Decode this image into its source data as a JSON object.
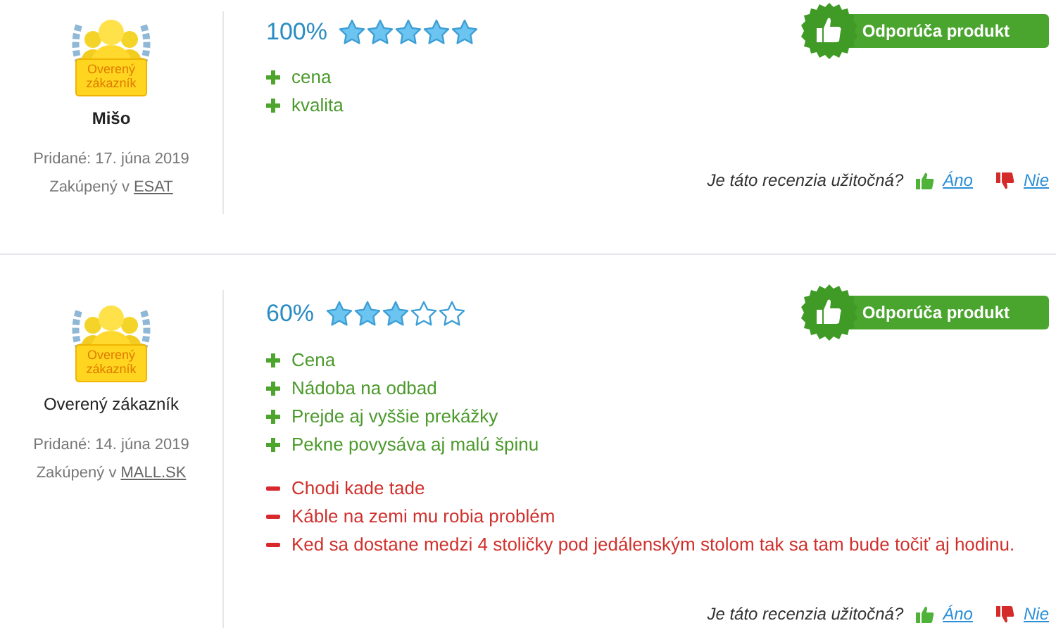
{
  "reviews": [
    {
      "badge_label": "Overený zákazník",
      "name": "Mišo",
      "added": "Pridané: 17. júna 2019",
      "purchased_prefix": "Zakúpený v",
      "shop": "ESAT",
      "percent": "100%",
      "stars": 5,
      "recommend": "Odporúča produkt",
      "pros": [
        "cena",
        "kvalita"
      ],
      "helpful_question": "Je táto recenzia užitočná?",
      "yes": "Áno",
      "no": "Nie"
    },
    {
      "badge_label": "Overený zákazník",
      "name": "Overený zákazník",
      "added": "Pridané: 14. júna 2019",
      "purchased_prefix": "Zakúpený v",
      "shop": "MALL.SK",
      "percent": "60%",
      "stars": 3,
      "recommend": "Odporúča produkt",
      "pros": [
        "Cena",
        "Nádoba na odbad",
        "Prejde aj vyššie prekážky",
        "Pekne povysáva aj malú špinu"
      ],
      "cons": [
        "Chodi kade tade",
        "Káble na zemi mu robia problém",
        "Ked sa dostane medzi 4 stoličky pod jedálenským stolom tak sa tam bude točiť aj hodinu."
      ],
      "helpful_question": "Je táto recenzia užitočná?",
      "yes": "Áno",
      "no": "Nie"
    }
  ]
}
